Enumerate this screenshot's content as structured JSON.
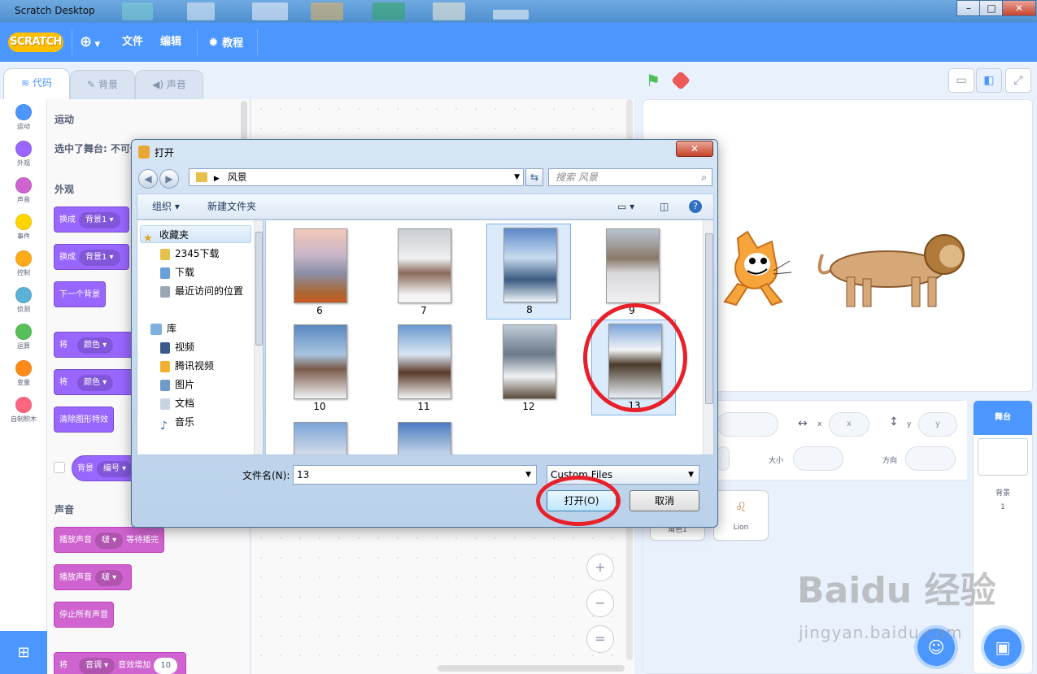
{
  "window": {
    "title": "Scratch Desktop"
  },
  "menubar": {
    "logo": "SCRATCH",
    "file": "文件",
    "edit": "编辑",
    "tutorials": "教程"
  },
  "tabs": [
    {
      "label": "代码"
    },
    {
      "label": "背景"
    },
    {
      "label": "声音"
    }
  ],
  "categories": [
    {
      "label": "运动",
      "color": "#4c97ff"
    },
    {
      "label": "外观",
      "color": "#9966ff"
    },
    {
      "label": "声音",
      "color": "#cf63cf"
    },
    {
      "label": "事件",
      "color": "#ffd500"
    },
    {
      "label": "控制",
      "color": "#ffab19"
    },
    {
      "label": "侦测",
      "color": "#5cb1d6"
    },
    {
      "label": "运算",
      "color": "#59c059"
    },
    {
      "label": "变量",
      "color": "#ff8c1a"
    },
    {
      "label": "自制积木",
      "color": "#ff6680"
    }
  ],
  "palette": {
    "motion_heading": "运动",
    "stage_selected": "选中了舞台: 不可使用运动类积木",
    "looks_heading": "外观",
    "block_switch1_verb": "换成",
    "block_switch1_value": "背景1",
    "block_switch2_verb": "换成",
    "block_switch2_value": "背景1",
    "block_next": "下一个背景",
    "block_effect1_verb": "将",
    "block_effect1_value": "颜色",
    "block_effect2_verb": "将",
    "block_effect2_value": "颜色",
    "block_clear": "清除图形特效",
    "block_backdrop_label": "背景",
    "block_backdrop_value": "编号",
    "sound_heading": "声音",
    "block_play_until": "播放声音",
    "block_play_until_value": "啵",
    "block_play_until_tail": "等待播完",
    "block_play": "播放声音",
    "block_play_value": "啵",
    "block_stop_all": "停止所有声音",
    "block_pitch_verb": "将",
    "block_pitch_value": "音调",
    "block_pitch_tail": "音效增加",
    "block_pitch_num": "10"
  },
  "zoom": {
    "in": "+",
    "out": "−",
    "reset": "="
  },
  "sprite_info": {
    "x_label": "x",
    "x_value": "x",
    "y_label": "y",
    "y_value": "y",
    "size_label": "大小",
    "direction_label": "方向"
  },
  "sprites": [
    {
      "name": "角色1"
    },
    {
      "name": "Lion"
    }
  ],
  "stage_panel": {
    "title": "舞台",
    "backdrop_label": "背景",
    "backdrop_count": "1"
  },
  "watermark": {
    "brand": "Baidu 经验",
    "url": "jingyan.baidu.com"
  },
  "dialog": {
    "title": "打开",
    "close": "✕",
    "path": "风景",
    "search_placeholder": "搜索 风景",
    "organize": "组织 ▾",
    "new_folder": "新建文件夹",
    "tree": [
      {
        "label": "收藏夹",
        "icon": "star-icon"
      },
      {
        "label": "2345下载",
        "icon": "folder-icon"
      },
      {
        "label": "下载",
        "icon": "download-folder-icon"
      },
      {
        "label": "最近访问的位置",
        "icon": "recent-places-icon"
      },
      {
        "label": "库",
        "icon": "library-icon"
      },
      {
        "label": "视频",
        "icon": "video-icon"
      },
      {
        "label": "腾讯视频",
        "icon": "tencent-video-icon"
      },
      {
        "label": "图片",
        "icon": "pictures-icon"
      },
      {
        "label": "文档",
        "icon": "documents-icon"
      },
      {
        "label": "音乐",
        "icon": "music-icon"
      }
    ],
    "files": [
      {
        "name": "6"
      },
      {
        "name": "7"
      },
      {
        "name": "8"
      },
      {
        "name": "9"
      },
      {
        "name": "10"
      },
      {
        "name": "11"
      },
      {
        "name": "12"
      },
      {
        "name": "13"
      },
      {
        "name": ""
      },
      {
        "name": ""
      }
    ],
    "filename_label": "文件名(N):",
    "filename_value": "13",
    "filter": "Custom Files",
    "open_button": "打开(O)",
    "cancel_button": "取消"
  }
}
